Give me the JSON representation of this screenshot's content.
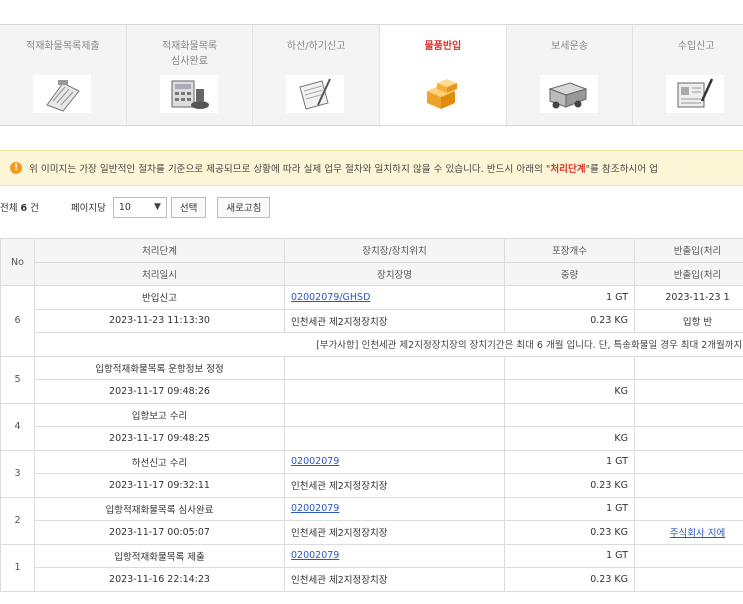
{
  "steps": [
    {
      "label": "적재화물목록제출",
      "icon": "clipboard-icon",
      "active": false
    },
    {
      "label": "적재화물목록\n심사완료",
      "icon": "calculator-stamp-icon",
      "active": false
    },
    {
      "label": "하선/하기신고",
      "icon": "document-pen-icon",
      "active": false
    },
    {
      "label": "물품반입",
      "icon": "boxes-icon",
      "active": true
    },
    {
      "label": "보세운송",
      "icon": "truck-icon",
      "active": false
    },
    {
      "label": "수입신고",
      "icon": "form-pen-icon",
      "active": false
    }
  ],
  "notice": {
    "icon": "warning-icon",
    "text_before": "위 이미지는 가장 일반적인 절차를 기준으로 제공되므로 상황에 따라 실제 업무 절차와 일치하지 않을 수 있습니다. 반드시 아래의 \"",
    "highlight": "처리단계",
    "text_after": "\"를 참조하시어 업"
  },
  "toolbar": {
    "total_prefix": "전체",
    "total_count": "6",
    "total_suffix": "건",
    "per_page_label": "페이지당",
    "per_page_value": "10",
    "select_button": "선택",
    "refresh_button": "새로고침"
  },
  "table": {
    "header_row1": [
      "No",
      "처리단계",
      "장치장/장치위치",
      "포장개수",
      "반출입(처리"
    ],
    "header_row2": [
      "처리일시",
      "장치장명",
      "중량",
      "반출입(처리"
    ],
    "rows": [
      {
        "no": "6",
        "stage": "반입신고",
        "datetime": "2023-11-23 11:13:30",
        "location_code": "02002079/GHSD",
        "location_name": "인천세관 제2지정장치장",
        "packages": "1 GT",
        "weight": "0.23 KG",
        "inout1": "2023-11-23 1",
        "inout2": "입항 반",
        "extra": "[부가사항] 인천세관 제2지정장치장의 장치기간은 최대 6 개월 입니다. 단, 특송화물일 경우 최대 2개월까지 장"
      },
      {
        "no": "5",
        "stage": "입항적재화물목록 운항정보 정정",
        "datetime": "2023-11-17 09:48:26",
        "location_code": "",
        "location_name": "",
        "packages": "",
        "weight": "KG",
        "inout1": "",
        "inout2": ""
      },
      {
        "no": "4",
        "stage": "입항보고 수리",
        "datetime": "2023-11-17 09:48:25",
        "location_code": "",
        "location_name": "",
        "packages": "",
        "weight": "KG",
        "inout1": "",
        "inout2": ""
      },
      {
        "no": "3",
        "stage": "하선신고 수리",
        "datetime": "2023-11-17 09:32:11",
        "location_code": "02002079",
        "location_name": "인천세관 제2지정장치장",
        "packages": "1 GT",
        "weight": "0.23 KG",
        "inout1": "",
        "inout2": ""
      },
      {
        "no": "2",
        "stage": "입항적재화물목록 심사완료",
        "datetime": "2023-11-17 00:05:07",
        "location_code": "02002079",
        "location_name": "인천세관 제2지정장치장",
        "packages": "1 GT",
        "weight": "0.23 KG",
        "inout1": "",
        "inout2": "주식회사 지에"
      },
      {
        "no": "1",
        "stage": "입항적재화물목록 제출",
        "datetime": "2023-11-16 22:14:23",
        "location_code": "02002079",
        "location_name": "인천세관 제2지정장치장",
        "packages": "1 GT",
        "weight": "0.23 KG",
        "inout1": "",
        "inout2": ""
      }
    ]
  }
}
